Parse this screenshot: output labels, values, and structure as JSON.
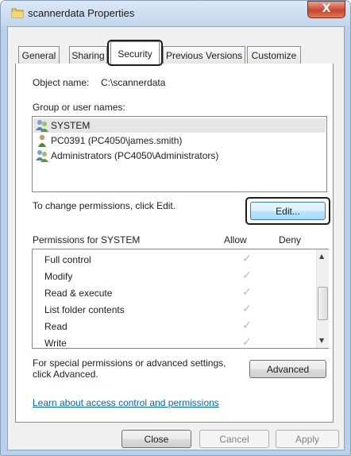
{
  "window": {
    "title": "scannerdata Properties",
    "close_glyph": "X"
  },
  "tabs": [
    {
      "label": "General"
    },
    {
      "label": "Sharing"
    },
    {
      "label": "Security"
    },
    {
      "label": "Previous Versions"
    },
    {
      "label": "Customize"
    }
  ],
  "object": {
    "label": "Object name:",
    "value": "C:\\scannerdata"
  },
  "groups": {
    "label": "Group or user names:",
    "items": [
      {
        "name": "SYSTEM",
        "icon": "group-users-icon"
      },
      {
        "name": "PC0391 (PC4050\\james.smith)",
        "icon": "user-icon"
      },
      {
        "name": "Administrators (PC4050\\Administrators)",
        "icon": "group-users-icon"
      }
    ]
  },
  "change_text": "To change permissions, click Edit.",
  "edit_button": "Edit...",
  "permissions": {
    "title": "Permissions for SYSTEM",
    "allow_label": "Allow",
    "deny_label": "Deny",
    "check_glyph": "✓",
    "rows": [
      {
        "name": "Full control",
        "allow": true,
        "deny": false
      },
      {
        "name": "Modify",
        "allow": true,
        "deny": false
      },
      {
        "name": "Read & execute",
        "allow": true,
        "deny": false
      },
      {
        "name": "List folder contents",
        "allow": true,
        "deny": false
      },
      {
        "name": "Read",
        "allow": true,
        "deny": false
      },
      {
        "name": "Write",
        "allow": true,
        "deny": false
      }
    ]
  },
  "special": {
    "line1": "For special permissions or advanced settings,",
    "line2": "click Advanced."
  },
  "advanced_button": "Advanced",
  "learn_link": "Learn about access control and permissions",
  "footer": {
    "close": "Close",
    "cancel": "Cancel",
    "apply": "Apply"
  },
  "highlight_color": "#1c1c1c"
}
